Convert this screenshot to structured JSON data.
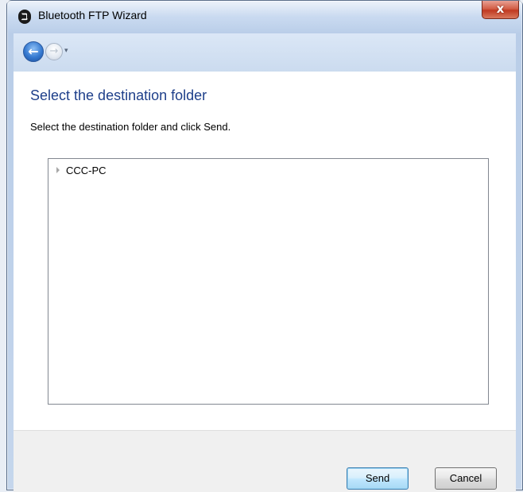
{
  "window": {
    "title": "Bluetooth FTP Wizard",
    "close_label": "x"
  },
  "icons": {
    "app": "bluetooth-icon",
    "back": "back-arrow-icon",
    "forward": "forward-arrow-icon",
    "dropdown": "chevron-down-icon"
  },
  "content": {
    "heading": "Select the destination folder",
    "instruction": "Select the destination folder and click Send."
  },
  "tree": {
    "items": [
      {
        "label": "CCC-PC",
        "expanded": false
      }
    ]
  },
  "buttons": {
    "send": "Send",
    "cancel": "Cancel"
  },
  "colors": {
    "heading": "#1e3f8a",
    "close_button": "#c03a22",
    "default_button_border": "#3c7fb1"
  }
}
